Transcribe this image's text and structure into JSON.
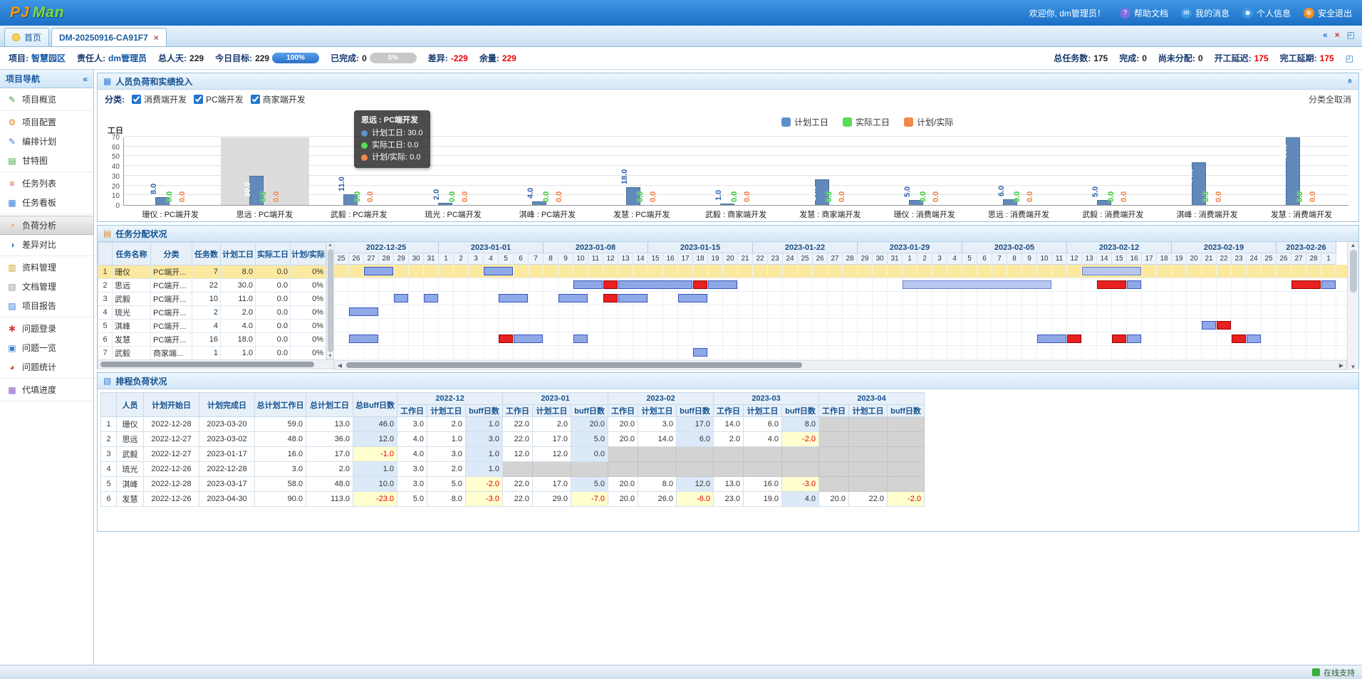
{
  "icons": {
    "tab_close": "×",
    "collapse_left": "«",
    "collapse_up": "«",
    "first": "«",
    "close_red": "×",
    "expand": "◰",
    "scroll_up": "▲",
    "scroll_down": "▼",
    "scroll_left": "◀",
    "scroll_right": "▶"
  },
  "header": {
    "logo_pj": "PJ",
    "logo_man": "Man",
    "welcome": "欢迎你, dm管理员！",
    "links": [
      {
        "name": "help-docs",
        "label": "帮助文档",
        "glyph": "?",
        "color": "#7b6fe0"
      },
      {
        "name": "my-messages",
        "label": "我的消息",
        "glyph": "✉",
        "color": "#3d9ae8"
      },
      {
        "name": "profile",
        "label": "个人信息",
        "glyph": "☻",
        "color": "#3d9ae8"
      },
      {
        "name": "logout",
        "label": "安全退出",
        "glyph": "⊗",
        "color": "#f09020"
      }
    ]
  },
  "tabs": {
    "home_label": "首页",
    "active_label": "DM-20250916-CA91F7"
  },
  "infobar": {
    "left": [
      {
        "name": "project",
        "label": "项目:",
        "value": "智慧园区",
        "vclass": "v-blue"
      },
      {
        "name": "owner",
        "label": "责任人:",
        "value": "dm管理员",
        "vclass": "v-blue"
      },
      {
        "name": "total-person-days",
        "label": "总人天:",
        "value": "229",
        "vclass": "v-dark"
      },
      {
        "name": "today-target",
        "label": "今日目标:",
        "value": "229",
        "vclass": "v-dark",
        "progress": 100,
        "ptext": "100%"
      },
      {
        "name": "completed",
        "label": "已完成:",
        "value": "0",
        "vclass": "v-dark",
        "progress": 0,
        "ptext": "0%"
      },
      {
        "name": "difference",
        "label": "差异:",
        "value": "-229",
        "vclass": "v-red"
      },
      {
        "name": "remaining",
        "label": "余量:",
        "value": "229",
        "vclass": "v-red"
      }
    ],
    "right": [
      {
        "name": "total-tasks",
        "label": "总任务数:",
        "value": "175",
        "vclass": "v-dark"
      },
      {
        "name": "done-tasks",
        "label": "完成:",
        "value": "0",
        "vclass": "v-dark"
      },
      {
        "name": "unassigned",
        "label": "尚未分配:",
        "value": "0",
        "vclass": "v-dark"
      },
      {
        "name": "start-delayed",
        "label": "开工延迟:",
        "value": "175",
        "vclass": "v-red"
      },
      {
        "name": "finish-delayed",
        "label": "完工延期:",
        "value": "175",
        "vclass": "v-red"
      }
    ]
  },
  "sidebar": {
    "title": "项目导航",
    "groups": [
      [
        {
          "name": "project-overview",
          "label": "项目概览",
          "glyph": "✎",
          "color": "#3aa63a"
        }
      ],
      [
        {
          "name": "project-config",
          "label": "项目配置",
          "glyph": "⚙",
          "color": "#e08a2e"
        },
        {
          "name": "schedule-plan",
          "label": "编排计划",
          "glyph": "✎",
          "color": "#3a7fd6"
        },
        {
          "name": "gantt-chart",
          "label": "甘特图",
          "glyph": "▤",
          "color": "#3aa63a"
        }
      ],
      [
        {
          "name": "task-list",
          "label": "任务列表",
          "glyph": "≡",
          "color": "#d64a3a"
        },
        {
          "name": "task-board",
          "label": "任务看板",
          "glyph": "▦",
          "color": "#3a7fd6"
        }
      ],
      [
        {
          "name": "load-analysis",
          "label": "负荷分析",
          "glyph": "◔",
          "color": "#e08a2e",
          "active": true
        },
        {
          "name": "diff-compare",
          "label": "差异对比",
          "glyph": "◑",
          "color": "#3a7fd6"
        }
      ],
      [
        {
          "name": "material-mgmt",
          "label": "资料管理",
          "glyph": "▥",
          "color": "#c8a02e"
        },
        {
          "name": "document-mgmt",
          "label": "文档管理",
          "glyph": "▧",
          "color": "#8a98a8"
        },
        {
          "name": "project-report",
          "label": "项目报告",
          "glyph": "▨",
          "color": "#3a7fd6"
        }
      ],
      [
        {
          "name": "issue-entry",
          "label": "问题登录",
          "glyph": "✱",
          "color": "#d63a3a"
        },
        {
          "name": "issue-list",
          "label": "问题一览",
          "glyph": "▣",
          "color": "#3a7fd6"
        },
        {
          "name": "issue-stats",
          "label": "问题统计",
          "glyph": "◕",
          "color": "#d64a3a"
        }
      ],
      [
        {
          "name": "progress-fill",
          "label": "代填进度",
          "glyph": "▩",
          "color": "#8a5ac8"
        }
      ]
    ]
  },
  "panel1": {
    "title": "人员负荷和实绩投入",
    "icon_glyph": "▦",
    "ylabel": "工日",
    "filter_label": "分类:",
    "filters": [
      {
        "label": "消费端开发",
        "checked": true
      },
      {
        "label": "PC端开发",
        "checked": true
      },
      {
        "label": "商家端开发",
        "checked": true
      }
    ],
    "clear_all": "分类全取消",
    "legend": [
      {
        "label": "计划工日",
        "color": "#6090c8"
      },
      {
        "label": "实际工日",
        "color": "#55dd55"
      },
      {
        "label": "计划/实际",
        "color": "#f4884a"
      }
    ],
    "tooltip": {
      "title": "思远 : PC端开发",
      "rows": [
        {
          "label": "计划工日:",
          "value": "30.0",
          "color": "#6090c8"
        },
        {
          "label": "实际工日:",
          "value": "0.0",
          "color": "#55dd55"
        },
        {
          "label": "计划/实际:",
          "value": "0.0",
          "color": "#f4884a"
        }
      ]
    }
  },
  "chart_data": {
    "type": "bar",
    "title": "人员负荷和实绩投入",
    "ylabel": "工日",
    "ylim": [
      0,
      70
    ],
    "yticks": [
      0,
      10,
      20,
      30,
      40,
      50,
      60,
      70
    ],
    "grid": true,
    "legend_position": "top",
    "highlight_index": 1,
    "categories": [
      "珊仪 : PC端开发",
      "思远 : PC端开发",
      "武毅 : PC端开发",
      "琉光 : PC端开发",
      "淇峰 : PC端开发",
      "发慧 : PC端开发",
      "武毅 : 商家端开发",
      "发慧 : 商家端开发",
      "珊仪 : 消费端开发",
      "思远 : 消费端开发",
      "武毅 : 消费端开发",
      "淇峰 : 消费端开发",
      "发慧 : 消费端开发"
    ],
    "series": [
      {
        "name": "计划工日",
        "values": [
          8,
          30,
          11,
          2,
          4,
          18,
          1,
          26,
          5,
          6,
          5,
          44,
          69
        ]
      },
      {
        "name": "实际工日",
        "values": [
          0,
          0,
          0,
          0,
          0,
          0,
          0,
          0,
          0,
          0,
          0,
          0,
          0
        ]
      },
      {
        "name": "计划/实际",
        "values": [
          0,
          0,
          0,
          0,
          0,
          0,
          0,
          0,
          0,
          0,
          0,
          0,
          0
        ]
      }
    ]
  },
  "panel2": {
    "title": "任务分配状况",
    "icon_glyph": "▤",
    "columns": [
      "任务名称",
      "分类",
      "任务数",
      "计划工日",
      "实际工日",
      "计划/实际"
    ],
    "rows": [
      {
        "no": "1",
        "name": "珊仪",
        "cat": "PC端开...",
        "count": "7",
        "plan": "8.0",
        "actual": "0.0",
        "ratio": "0%"
      },
      {
        "no": "2",
        "name": "思远",
        "cat": "PC端开...",
        "count": "22",
        "plan": "30.0",
        "actual": "0.0",
        "ratio": "0%"
      },
      {
        "no": "3",
        "name": "武毅",
        "cat": "PC端开...",
        "count": "10",
        "plan": "11.0",
        "actual": "0.0",
        "ratio": "0%"
      },
      {
        "no": "4",
        "name": "琉光",
        "cat": "PC端开...",
        "count": "2",
        "plan": "2.0",
        "actual": "0.0",
        "ratio": "0%"
      },
      {
        "no": "5",
        "name": "淇峰",
        "cat": "PC端开...",
        "count": "4",
        "plan": "4.0",
        "actual": "0.0",
        "ratio": "0%"
      },
      {
        "no": "6",
        "name": "发慧",
        "cat": "PC端开...",
        "count": "16",
        "plan": "18.0",
        "actual": "0.0",
        "ratio": "0%"
      },
      {
        "no": "7",
        "name": "武毅",
        "cat": "商家端...",
        "count": "1",
        "plan": "1.0",
        "actual": "0.0",
        "ratio": "0%"
      }
    ],
    "weeks": [
      {
        "label": "2022-12-25",
        "days": [
          "25",
          "26",
          "27",
          "28",
          "29",
          "30",
          "31"
        ]
      },
      {
        "label": "2023-01-01",
        "days": [
          "1",
          "2",
          "3",
          "4",
          "5",
          "6",
          "7"
        ]
      },
      {
        "label": "2023-01-08",
        "days": [
          "8",
          "9",
          "10",
          "11",
          "12",
          "13",
          "14"
        ]
      },
      {
        "label": "2023-01-15",
        "days": [
          "15",
          "16",
          "17",
          "18",
          "19",
          "20",
          "21"
        ]
      },
      {
        "label": "2023-01-22",
        "days": [
          "22",
          "23",
          "24",
          "25",
          "26",
          "27",
          "28"
        ]
      },
      {
        "label": "2023-01-29",
        "days": [
          "29",
          "30",
          "31",
          "1",
          "2",
          "3",
          "4"
        ]
      },
      {
        "label": "2023-02-05",
        "days": [
          "5",
          "6",
          "7",
          "8",
          "9",
          "10",
          "11"
        ]
      },
      {
        "label": "2023-02-12",
        "days": [
          "12",
          "13",
          "14",
          "15",
          "16",
          "17",
          "18"
        ]
      },
      {
        "label": "2023-02-19",
        "days": [
          "19",
          "20",
          "21",
          "22",
          "23",
          "24",
          "25"
        ]
      },
      {
        "label": "2023-02-26",
        "days": [
          "26",
          "27",
          "28",
          "1"
        ]
      }
    ],
    "gantt": [
      [
        {
          "s": 2,
          "l": 2,
          "c": "b"
        },
        {
          "s": 10,
          "l": 2,
          "c": "b"
        },
        {
          "s": 50,
          "l": 4,
          "c": "lb"
        }
      ],
      [
        {
          "s": 16,
          "l": 2,
          "c": "b"
        },
        {
          "s": 18,
          "l": 1,
          "c": "r"
        },
        {
          "s": 19,
          "l": 5,
          "c": "b"
        },
        {
          "s": 24,
          "l": 1,
          "c": "r"
        },
        {
          "s": 25,
          "l": 2,
          "c": "b"
        },
        {
          "s": 38,
          "l": 10,
          "c": "lb"
        },
        {
          "s": 51,
          "l": 2,
          "c": "r"
        },
        {
          "s": 53,
          "l": 1,
          "c": "b"
        },
        {
          "s": 64,
          "l": 2,
          "c": "r"
        },
        {
          "s": 66,
          "l": 1,
          "c": "b"
        }
      ],
      [
        {
          "s": 4,
          "l": 1,
          "c": "b"
        },
        {
          "s": 6,
          "l": 1,
          "c": "b"
        },
        {
          "s": 11,
          "l": 2,
          "c": "b"
        },
        {
          "s": 15,
          "l": 2,
          "c": "b"
        },
        {
          "s": 18,
          "l": 1,
          "c": "r"
        },
        {
          "s": 19,
          "l": 2,
          "c": "b"
        },
        {
          "s": 23,
          "l": 2,
          "c": "b"
        }
      ],
      [
        {
          "s": 1,
          "l": 2,
          "c": "b"
        }
      ],
      [
        {
          "s": 58,
          "l": 1,
          "c": "b"
        },
        {
          "s": 59,
          "l": 1,
          "c": "r"
        }
      ],
      [
        {
          "s": 1,
          "l": 2,
          "c": "b"
        },
        {
          "s": 11,
          "l": 1,
          "c": "r"
        },
        {
          "s": 12,
          "l": 2,
          "c": "b"
        },
        {
          "s": 16,
          "l": 1,
          "c": "b"
        },
        {
          "s": 47,
          "l": 2,
          "c": "b"
        },
        {
          "s": 49,
          "l": 1,
          "c": "r"
        },
        {
          "s": 52,
          "l": 1,
          "c": "r"
        },
        {
          "s": 53,
          "l": 1,
          "c": "b"
        },
        {
          "s": 60,
          "l": 1,
          "c": "r"
        },
        {
          "s": 61,
          "l": 1,
          "c": "b"
        }
      ],
      [
        {
          "s": 24,
          "l": 1,
          "c": "b"
        }
      ]
    ]
  },
  "panel3": {
    "title": "排程负荷状况",
    "icon_glyph": "▧",
    "fixed_columns": [
      "",
      "人员",
      "计划开始日",
      "计划完成日",
      "总计划工作日",
      "总计划工日",
      "总Buff日数"
    ],
    "months": [
      "2022-12",
      "2023-01",
      "2023-02",
      "2023-03",
      "2023-04"
    ],
    "sub_columns": [
      "工作日",
      "计划工日",
      "buff日数"
    ],
    "rows": [
      {
        "no": "1",
        "name": "珊仪",
        "start": "2022-12-28",
        "end": "2023-03-20",
        "total_work": "59.0",
        "total_plan": "13.0",
        "total_buff": "46.0",
        "cells": [
          [
            "3.0",
            "2.0",
            "1.0"
          ],
          [
            "22.0",
            "2.0",
            "20.0"
          ],
          [
            "20.0",
            "3.0",
            "17.0"
          ],
          [
            "14.0",
            "6.0",
            "8.0"
          ],
          null
        ]
      },
      {
        "no": "2",
        "name": "思远",
        "start": "2022-12-27",
        "end": "2023-03-02",
        "total_work": "48.0",
        "total_plan": "36.0",
        "total_buff": "12.0",
        "cells": [
          [
            "4.0",
            "1.0",
            "3.0"
          ],
          [
            "22.0",
            "17.0",
            "5.0"
          ],
          [
            "20.0",
            "14.0",
            "6.0"
          ],
          [
            "2.0",
            "4.0",
            "-2.0"
          ],
          null
        ]
      },
      {
        "no": "3",
        "name": "武毅",
        "start": "2022-12-27",
        "end": "2023-01-17",
        "total_work": "16.0",
        "total_plan": "17.0",
        "total_buff": "-1.0",
        "cells": [
          [
            "4.0",
            "3.0",
            "1.0"
          ],
          [
            "12.0",
            "12.0",
            "0.0"
          ],
          null,
          null,
          null
        ]
      },
      {
        "no": "4",
        "name": "琉光",
        "start": "2022-12-26",
        "end": "2022-12-28",
        "total_work": "3.0",
        "total_plan": "2.0",
        "total_buff": "1.0",
        "cells": [
          [
            "3.0",
            "2.0",
            "1.0"
          ],
          null,
          null,
          null,
          null
        ]
      },
      {
        "no": "5",
        "name": "淇峰",
        "start": "2022-12-28",
        "end": "2023-03-17",
        "total_work": "58.0",
        "total_plan": "48.0",
        "total_buff": "10.0",
        "cells": [
          [
            "3.0",
            "5.0",
            "-2.0"
          ],
          [
            "22.0",
            "17.0",
            "5.0"
          ],
          [
            "20.0",
            "8.0",
            "12.0"
          ],
          [
            "13.0",
            "16.0",
            "-3.0"
          ],
          null
        ]
      },
      {
        "no": "6",
        "name": "发慧",
        "start": "2022-12-26",
        "end": "2023-04-30",
        "total_work": "90.0",
        "total_plan": "113.0",
        "total_buff": "-23.0",
        "cells": [
          [
            "5.0",
            "8.0",
            "-3.0"
          ],
          [
            "22.0",
            "29.0",
            "-7.0"
          ],
          [
            "20.0",
            "26.0",
            "-6.0"
          ],
          [
            "23.0",
            "19.0",
            "4.0"
          ],
          [
            "20.0",
            "22.0",
            "-2.0"
          ]
        ]
      }
    ]
  },
  "statusbar": {
    "online_label": "在线支持"
  }
}
